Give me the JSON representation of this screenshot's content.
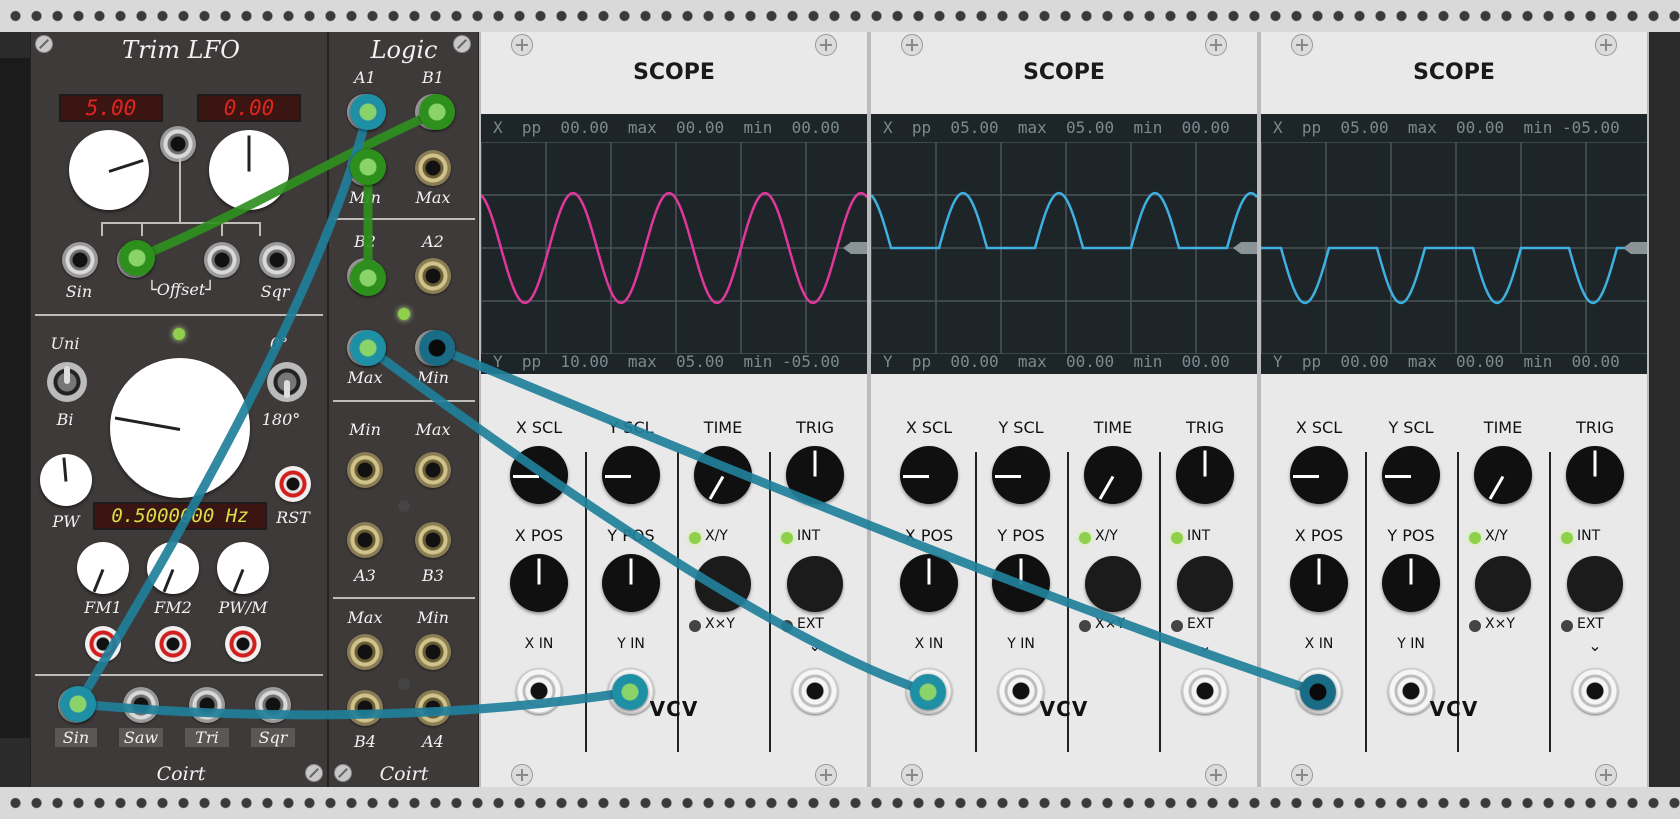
{
  "lfo": {
    "title": "Trim  LFO",
    "display_left": "5.00",
    "display_right": "0.00",
    "label_sin_top": "Sin",
    "label_offset": "└Offset┘",
    "label_sqr_top": "Sqr",
    "label_uni": "Uni",
    "label_bi": "Bi",
    "label_0deg": "0°",
    "label_180deg": "180°",
    "label_pw": "PW",
    "freq_display": "0.5000000 Hz",
    "label_rst": "RST",
    "label_fm1": "FM1",
    "label_fm2": "FM2",
    "label_pwm": "PW/M",
    "label_sin": "Sin",
    "label_saw": "Saw",
    "label_tri": "Tri",
    "label_sqr": "Sqr",
    "brand": "Coirt"
  },
  "logic": {
    "title": "Logic",
    "a1": "A1",
    "b1": "B1",
    "min1": "Min",
    "max1": "Max",
    "b2": "B2",
    "a2": "A2",
    "max2": "Max",
    "min2": "Min",
    "min3": "Min",
    "max3": "Max",
    "a3": "A3",
    "b3": "B3",
    "max4": "Max",
    "min4": "Min",
    "b4": "B4",
    "a4": "A4",
    "brand": "Coirt"
  },
  "scopes": [
    {
      "title": "SCOPE",
      "x_stats": "X  pp  00.00  max  00.00  min  00.00",
      "y_stats": "Y  pp  10.00  max  05.00  min -05.00",
      "wave_color": "#e0389a",
      "labels": {
        "x_scl": "X SCL",
        "y_scl": "Y SCL",
        "time": "TIME",
        "trig": "TRIG",
        "x_pos": "X POS",
        "y_pos": "Y POS",
        "xy": "X/Y",
        "int": "INT",
        "xxy": "X×Y",
        "ext": "EXT",
        "x_in": "X IN",
        "y_in": "Y IN"
      },
      "brand": "VCV"
    },
    {
      "title": "SCOPE",
      "x_stats": "X  pp  05.00  max  05.00  min  00.00",
      "y_stats": "Y  pp  00.00  max  00.00  min  00.00",
      "wave_color": "#3fb0e0",
      "labels": {
        "x_scl": "X SCL",
        "y_scl": "Y SCL",
        "time": "TIME",
        "trig": "TRIG",
        "x_pos": "X POS",
        "y_pos": "Y POS",
        "xy": "X/Y",
        "int": "INT",
        "xxy": "X×Y",
        "ext": "EXT",
        "x_in": "X IN",
        "y_in": "Y IN"
      },
      "brand": "VCV"
    },
    {
      "title": "SCOPE",
      "x_stats": "X  pp  05.00  max  00.00  min -05.00",
      "y_stats": "Y  pp  00.00  max  00.00  min  00.00",
      "wave_color": "#3fb0e0",
      "labels": {
        "x_scl": "X SCL",
        "y_scl": "Y SCL",
        "time": "TIME",
        "trig": "TRIG",
        "x_pos": "X POS",
        "y_pos": "Y POS",
        "xy": "X/Y",
        "int": "INT",
        "xxy": "X×Y",
        "ext": "EXT",
        "x_in": "X IN",
        "y_in": "Y IN"
      },
      "brand": "VCV"
    }
  ],
  "colors": {
    "cable_green": "#2f8f1f",
    "cable_blue": "#1f7f9a",
    "rail": "#d9d9d9",
    "panel_dark": "#3d3a39",
    "scope_panel": "#e9e9e9",
    "scope_screen": "#1d2528"
  }
}
